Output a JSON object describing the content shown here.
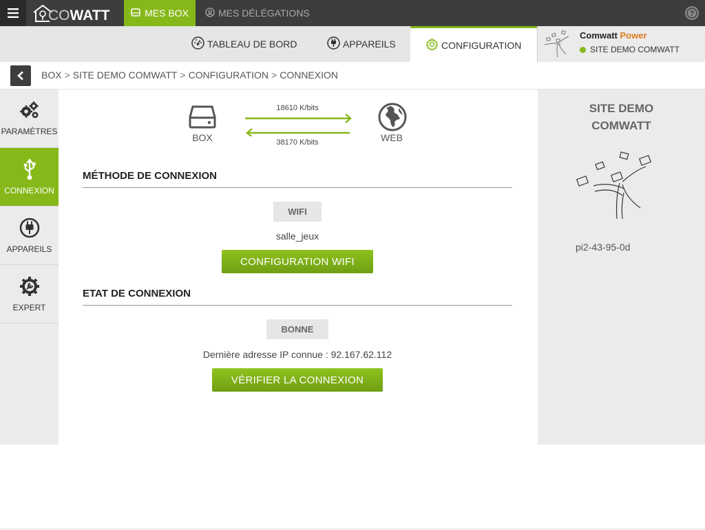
{
  "app": {
    "logo_text_co": "CO",
    "logo_text_watt": "WATT",
    "accent": "#86b81a"
  },
  "topnav": {
    "mes_box": "MES BOX",
    "mes_delegations": "MES DÉLÉGATIONS"
  },
  "subnav": {
    "tableau": "TABLEAU DE BORD",
    "appareils": "APPAREILS",
    "configuration": "CONFIGURATION"
  },
  "site": {
    "brand": "Comwatt",
    "brand_power": "Power",
    "status": "SITE DEMO COMWATT",
    "status_color": "#86b81a"
  },
  "breadcrumb": {
    "items": [
      "BOX",
      "SITE DEMO COMWATT",
      "CONFIGURATION",
      "CONNEXION"
    ],
    "sep": ">"
  },
  "sidebar": {
    "items": [
      {
        "label": "PARAMÈTRES",
        "icon": "gears-icon"
      },
      {
        "label": "CONNEXION",
        "icon": "usb-icon"
      },
      {
        "label": "APPAREILS",
        "icon": "plug-icon"
      },
      {
        "label": "EXPERT",
        "icon": "wrench-gear-icon"
      }
    ]
  },
  "diagram": {
    "box_label": "BOX",
    "web_label": "WEB",
    "upload_rate": "18610 K/bits",
    "download_rate": "38170 K/bits"
  },
  "methode": {
    "title": "MÉTHODE DE CONNEXION",
    "type": "WIFI",
    "ssid": "salle_jeux",
    "config_button": "CONFIGURATION WIFI"
  },
  "etat": {
    "title": "ETAT DE CONNEXION",
    "status": "BONNE",
    "ip_text": "Dernière adresse IP connue : 92.167.62.112",
    "verify_button": "VÉRIFIER LA CONNEXION"
  },
  "rightpanel": {
    "title_line1": "SITE DEMO",
    "title_line2": "COMWATT",
    "device_id": "pi2-43-95-0d"
  }
}
